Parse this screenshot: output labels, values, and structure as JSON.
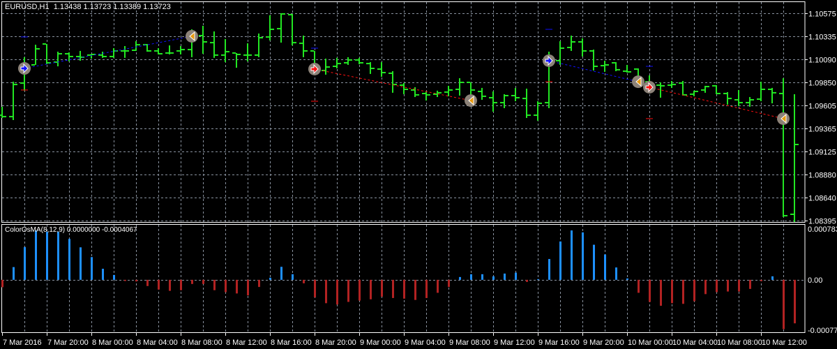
{
  "header": {
    "symbol": "EURUSD,H1",
    "ohlc_text": "1.13438 1.13723 1.13389 1.13723"
  },
  "indicator_header": {
    "name": "ColorOsMA(8,12,9)",
    "values_text": "0.0000000 -0.0004067"
  },
  "colors": {
    "background": "#000000",
    "bars": "#22e622",
    "grid": "#8a93a0",
    "osma_up": "#1e90ff",
    "osma_down": "#b22222",
    "buy": "#1010ff",
    "sell": "#ff1010",
    "close_marker": "#e89a10",
    "marker_circle": "#8c8278",
    "frame": "#ffffff"
  },
  "chart_data": [
    {
      "type": "ohlc",
      "title": "EURUSD,H1",
      "grid": true,
      "ylim": [
        1.08395,
        1.10575
      ],
      "y_ticks": [
        "1.10575",
        "1.10335",
        "1.10090",
        "1.09850",
        "1.09605",
        "1.09365",
        "1.09125",
        "1.08880",
        "1.08640",
        "1.08395"
      ],
      "x_ticks": [
        {
          "label": "7 Mar 2016",
          "at": "7 Mar 16:00"
        },
        {
          "label": "7 Mar 20:00",
          "at": "7 Mar 20:00"
        },
        {
          "label": "8 Mar 00:00",
          "at": "8 Mar 00:00"
        },
        {
          "label": "8 Mar 04:00",
          "at": "8 Mar 04:00"
        },
        {
          "label": "8 Mar 08:00",
          "at": "8 Mar 08:00"
        },
        {
          "label": "8 Mar 12:00",
          "at": "8 Mar 12:00"
        },
        {
          "label": "8 Mar 16:00",
          "at": "8 Mar 16:00"
        },
        {
          "label": "8 Mar 20:00",
          "at": "8 Mar 20:00"
        },
        {
          "label": "9 Mar 00:00",
          "at": "9 Mar 00:00"
        },
        {
          "label": "9 Mar 04:00",
          "at": "9 Mar 04:00"
        },
        {
          "label": "9 Mar 08:00",
          "at": "9 Mar 08:00"
        },
        {
          "label": "9 Mar 12:00",
          "at": "9 Mar 12:00"
        },
        {
          "label": "9 Mar 16:00",
          "at": "9 Mar 16:00"
        },
        {
          "label": "9 Mar 20:00",
          "at": "9 Mar 20:00"
        },
        {
          "label": "10 Mar 00:00",
          "at": "10 Mar 00:00"
        },
        {
          "label": "10 Mar 04:00",
          "at": "10 Mar 04:00"
        },
        {
          "label": "10 Mar 08:00",
          "at": "10 Mar 08:00"
        },
        {
          "label": "10 Mar 12:00",
          "at": "10 Mar 12:00"
        }
      ],
      "x": [
        "7 Mar 16:00",
        "7 Mar 17:00",
        "7 Mar 18:00",
        "7 Mar 19:00",
        "7 Mar 20:00",
        "7 Mar 21:00",
        "7 Mar 22:00",
        "7 Mar 23:00",
        "8 Mar 00:00",
        "8 Mar 01:00",
        "8 Mar 02:00",
        "8 Mar 03:00",
        "8 Mar 04:00",
        "8 Mar 05:00",
        "8 Mar 06:00",
        "8 Mar 07:00",
        "8 Mar 08:00",
        "8 Mar 09:00",
        "8 Mar 10:00",
        "8 Mar 11:00",
        "8 Mar 12:00",
        "8 Mar 13:00",
        "8 Mar 14:00",
        "8 Mar 15:00",
        "8 Mar 16:00",
        "8 Mar 17:00",
        "8 Mar 18:00",
        "8 Mar 19:00",
        "8 Mar 20:00",
        "8 Mar 21:00",
        "8 Mar 22:00",
        "8 Mar 23:00",
        "9 Mar 00:00",
        "9 Mar 01:00",
        "9 Mar 02:00",
        "9 Mar 03:00",
        "9 Mar 04:00",
        "9 Mar 05:00",
        "9 Mar 06:00",
        "9 Mar 07:00",
        "9 Mar 08:00",
        "9 Mar 09:00",
        "9 Mar 10:00",
        "9 Mar 11:00",
        "9 Mar 12:00",
        "9 Mar 13:00",
        "9 Mar 14:00",
        "9 Mar 15:00",
        "9 Mar 16:00",
        "9 Mar 17:00",
        "9 Mar 18:00",
        "9 Mar 19:00",
        "9 Mar 20:00",
        "9 Mar 21:00",
        "9 Mar 22:00",
        "9 Mar 23:00",
        "10 Mar 00:00",
        "10 Mar 01:00",
        "10 Mar 02:00",
        "10 Mar 03:00",
        "10 Mar 04:00",
        "10 Mar 05:00",
        "10 Mar 06:00",
        "10 Mar 07:00",
        "10 Mar 08:00",
        "10 Mar 09:00",
        "10 Mar 10:00",
        "10 Mar 11:00",
        "10 Mar 12:00",
        "10 Mar 13:00",
        "10 Mar 14:00",
        "10 Mar 15:00"
      ],
      "ohlc": [
        [
          1.09503,
          1.09592,
          1.09474,
          1.09488
        ],
        [
          1.09488,
          1.09855,
          1.09452,
          1.09826
        ],
        [
          1.09841,
          1.10113,
          1.09761,
          1.10024
        ],
        [
          1.10032,
          1.10244,
          1.10032,
          1.10201
        ],
        [
          1.10252,
          1.10252,
          1.10039,
          1.10054
        ],
        [
          1.10061,
          1.10171,
          1.10017,
          1.10149
        ],
        [
          1.10149,
          1.10164,
          1.10069,
          1.1012
        ],
        [
          1.1012,
          1.10179,
          1.10076,
          1.10113
        ],
        [
          1.10135,
          1.10149,
          1.10098,
          1.10142
        ],
        [
          1.10135,
          1.10171,
          1.10106,
          1.1012
        ],
        [
          1.1012,
          1.10208,
          1.10106,
          1.10179
        ],
        [
          1.10179,
          1.1023,
          1.10106,
          1.10179
        ],
        [
          1.10186,
          1.10281,
          1.10179,
          1.10244
        ],
        [
          1.10244,
          1.10252,
          1.10171,
          1.10179
        ],
        [
          1.10179,
          1.10208,
          1.10142,
          1.10149
        ],
        [
          1.10157,
          1.10237,
          1.10142,
          1.10157
        ],
        [
          1.10179,
          1.1023,
          1.10142,
          1.10193
        ],
        [
          1.10193,
          1.10406,
          1.10113,
          1.10333
        ],
        [
          1.1034,
          1.10443,
          1.10149,
          1.10274
        ],
        [
          1.10266,
          1.10384,
          1.10106,
          1.10135
        ],
        [
          1.10135,
          1.10304,
          1.10061,
          1.10171
        ],
        [
          1.10157,
          1.10157,
          1.10002,
          1.10142
        ],
        [
          1.10135,
          1.10259,
          1.10069,
          1.10135
        ],
        [
          1.10135,
          1.10362,
          1.10113,
          1.10318
        ],
        [
          1.10326,
          1.10553,
          1.10289,
          1.10406
        ],
        [
          1.10413,
          1.10575,
          1.10266,
          1.10568
        ],
        [
          1.1056,
          1.10568,
          1.10237,
          1.10266
        ],
        [
          1.10259,
          1.1034,
          1.10113,
          1.10179
        ],
        [
          1.10179,
          1.10179,
          1.09929,
          1.09973
        ],
        [
          1.09973,
          1.10098,
          1.09929,
          1.1001
        ],
        [
          1.10017,
          1.10106,
          1.09995,
          1.10046
        ],
        [
          1.10054,
          1.10113,
          1.10032,
          1.10084
        ],
        [
          1.10084,
          1.10106,
          1.10039,
          1.10054
        ],
        [
          1.10046,
          1.10061,
          1.09937,
          1.09995
        ],
        [
          1.09988,
          1.10061,
          1.09907,
          1.09951
        ],
        [
          1.09944,
          1.09966,
          1.09739,
          1.09826
        ],
        [
          1.09819,
          1.09841,
          1.09724,
          1.09775
        ],
        [
          1.09768,
          1.09797,
          1.09694,
          1.09717
        ],
        [
          1.09731,
          1.09753,
          1.09657,
          1.09717
        ],
        [
          1.09724,
          1.09761,
          1.09694,
          1.09739
        ],
        [
          1.09746,
          1.09812,
          1.09702,
          1.09768
        ],
        [
          1.09775,
          1.09892,
          1.09709,
          1.09848
        ],
        [
          1.09848,
          1.09848,
          1.09614,
          1.09768
        ],
        [
          1.09753,
          1.0979,
          1.09665,
          1.09702
        ],
        [
          1.09687,
          1.09753,
          1.0954,
          1.09635
        ],
        [
          1.09635,
          1.09724,
          1.09577,
          1.09709
        ],
        [
          1.09709,
          1.0979,
          1.0965,
          1.09687
        ],
        [
          1.09679,
          1.09782,
          1.09474,
          1.09503
        ],
        [
          1.09503,
          1.0965,
          1.09445,
          1.09628
        ],
        [
          1.09635,
          1.10171,
          1.09577,
          1.10054
        ],
        [
          1.10076,
          1.10281,
          1.10032,
          1.10208
        ],
        [
          1.10215,
          1.1034,
          1.10179,
          1.10274
        ],
        [
          1.10274,
          1.10311,
          1.1012,
          1.10179
        ],
        [
          1.10179,
          1.10193,
          1.09973,
          1.10017
        ],
        [
          1.10024,
          1.10076,
          1.09959,
          1.10032
        ],
        [
          1.10054,
          1.10061,
          1.09966,
          1.09981
        ],
        [
          1.09966,
          1.10032,
          1.09951,
          1.09959
        ],
        [
          1.09988,
          1.09995,
          1.09834,
          1.09848
        ],
        [
          1.09855,
          1.09922,
          1.09797,
          1.09841
        ],
        [
          1.09819,
          1.09848,
          1.09687,
          1.09812
        ],
        [
          1.09819,
          1.09863,
          1.0979,
          1.09826
        ],
        [
          1.09841,
          1.09863,
          1.09709,
          1.09717
        ],
        [
          1.09724,
          1.09761,
          1.09702,
          1.09753
        ],
        [
          1.09768,
          1.09812,
          1.09739,
          1.09804
        ],
        [
          1.09812,
          1.09819,
          1.09724,
          1.09731
        ],
        [
          1.09731,
          1.09746,
          1.09614,
          1.09679
        ],
        [
          1.09665,
          1.09768,
          1.09599,
          1.09635
        ],
        [
          1.09635,
          1.09694,
          1.09592,
          1.09665
        ],
        [
          1.09672,
          1.09855,
          1.0965,
          1.09775
        ],
        [
          1.09775,
          1.0979,
          1.09628,
          1.09739
        ],
        [
          1.09731,
          1.09892,
          1.08432,
          1.08446
        ],
        [
          1.08461,
          1.09724,
          1.0838,
          1.09195
        ]
      ],
      "signals": [
        {
          "bar": "7 Mar 18:00",
          "type": "buy",
          "price": 1.09995,
          "close_bar": "8 Mar 09:00",
          "close_price": 1.10333,
          "tp": 1.10326,
          "sl": 1.09768
        },
        {
          "bar": "8 Mar 20:00",
          "type": "sell",
          "price": 1.09988,
          "close_bar": "9 Mar 10:00",
          "close_price": 1.09657,
          "tp": 1.0965,
          "sl": 1.10208
        },
        {
          "bar": "9 Mar 17:00",
          "type": "buy",
          "price": 1.10076,
          "close_bar": "10 Mar 01:00",
          "close_price": 1.09855,
          "tp": 1.10406,
          "sl": 1.09855
        },
        {
          "bar": "10 Mar 02:00",
          "type": "sell",
          "price": 1.09797,
          "close_bar": "10 Mar 14:00",
          "close_price": 1.09467,
          "tp": 1.09467,
          "sl": 1.10017
        }
      ]
    },
    {
      "type": "bar",
      "title": "ColorOsMA(8,12,9)",
      "ylim": [
        -0.000775,
        0.000783
      ],
      "y_ticks": [
        "0.000783",
        "0.00",
        "-0.000775"
      ],
      "values": [
        -0.000114,
        0.000196,
        0.000503,
        0.00076,
        0.00074,
        0.00074,
        0.00063,
        0.0005,
        0.00035,
        0.00017,
        7.5e-05,
        -1.8e-05,
        -2.5e-05,
        -9.6e-05,
        -0.00015,
        -0.00017,
        -0.00016,
        -6.4e-05,
        -6.4e-05,
        -0.00016,
        -0.00019,
        -0.00021,
        -0.00024,
        -0.00011,
        3.2e-05,
        0.0002,
        8.6e-05,
        -5.4e-05,
        -0.00027,
        -0.00036,
        -0.00038,
        -0.00034,
        -0.00032,
        -0.0003,
        -0.00026,
        -0.00028,
        -0.00029,
        -0.00031,
        -0.00028,
        -0.0002,
        -0.00011,
        4.3e-05,
        8.6e-05,
        8.6e-05,
        5.4e-05,
        9.6e-05,
        0.00011,
        -3.2e-05,
        1.1e-05,
        0.00032,
        0.00059,
        0.00076,
        0.00073,
        0.00054,
        0.00039,
        0.00019,
        2.1e-05,
        -0.0002,
        -0.00034,
        -0.0004,
        -0.00036,
        -0.00037,
        -0.00033,
        -0.00022,
        -0.00019,
        -0.00018,
        -0.00018,
        -0.00014,
        -2.1e-05,
        5.4e-05,
        -0.00076,
        -0.00067
      ]
    }
  ]
}
